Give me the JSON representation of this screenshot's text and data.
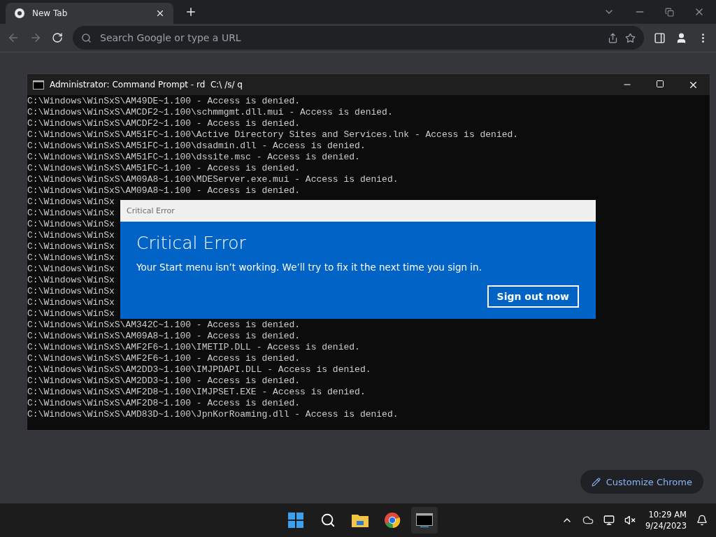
{
  "browser": {
    "tabs": [
      {
        "title": "New Tab",
        "selected": true
      }
    ],
    "address_bar": {
      "placeholder": "Search Google or type a URL"
    },
    "customize_button": "Customize Chrome"
  },
  "console": {
    "title": "Administrator: Command Prompt - rd  C:\\ /s/ q",
    "lines": [
      "C:\\Windows\\WinSxS\\AM49DE~1.100 - Access is denied.",
      "C:\\Windows\\WinSxS\\AMCDF2~1.100\\schmmgmt.dll.mui - Access is denied.",
      "C:\\Windows\\WinSxS\\AMCDF2~1.100 - Access is denied.",
      "C:\\Windows\\WinSxS\\AM51FC~1.100\\Active Directory Sites and Services.lnk - Access is denied.",
      "C:\\Windows\\WinSxS\\AM51FC~1.100\\dsadmin.dll - Access is denied.",
      "C:\\Windows\\WinSxS\\AM51FC~1.100\\dssite.msc - Access is denied.",
      "C:\\Windows\\WinSxS\\AM51FC~1.100 - Access is denied.",
      "C:\\Windows\\WinSxS\\AM09A8~1.100\\MDEServer.exe.mui - Access is denied.",
      "C:\\Windows\\WinSxS\\AM09A8~1.100 - Access is denied.",
      "C:\\Windows\\WinSx",
      "C:\\Windows\\WinSx",
      "C:\\Windows\\WinSx",
      "C:\\Windows\\WinSx",
      "C:\\Windows\\WinSx",
      "C:\\Windows\\WinSx",
      "C:\\Windows\\WinSx",
      "C:\\Windows\\WinSx",
      "C:\\Windows\\WinSx",
      "C:\\Windows\\WinSx",
      "C:\\Windows\\WinSx",
      "C:\\Windows\\WinSxS\\AM342C~1.100 - Access is denied.",
      "C:\\Windows\\WinSxS\\AM09A8~1.100 - Access is denied.",
      "C:\\Windows\\WinSxS\\AMF2F6~1.100\\IMETIP.DLL - Access is denied.",
      "C:\\Windows\\WinSxS\\AMF2F6~1.100 - Access is denied.",
      "C:\\Windows\\WinSxS\\AM2DD3~1.100\\IMJPDAPI.DLL - Access is denied.",
      "C:\\Windows\\WinSxS\\AM2DD3~1.100 - Access is denied.",
      "C:\\Windows\\WinSxS\\AMF2D8~1.100\\IMJPSET.EXE - Access is denied.",
      "C:\\Windows\\WinSxS\\AMF2D8~1.100 - Access is denied.",
      "C:\\Windows\\WinSxS\\AMD83D~1.100\\JpnKorRoaming.dll - Access is denied."
    ]
  },
  "dialog": {
    "title": "Critical Error",
    "heading": "Critical Error",
    "message": "Your Start menu isn’t working. We’ll try to fix it the next time you sign in.",
    "button": "Sign out now"
  },
  "taskbar": {
    "time": "10:29 AM",
    "date": "9/24/2023"
  }
}
